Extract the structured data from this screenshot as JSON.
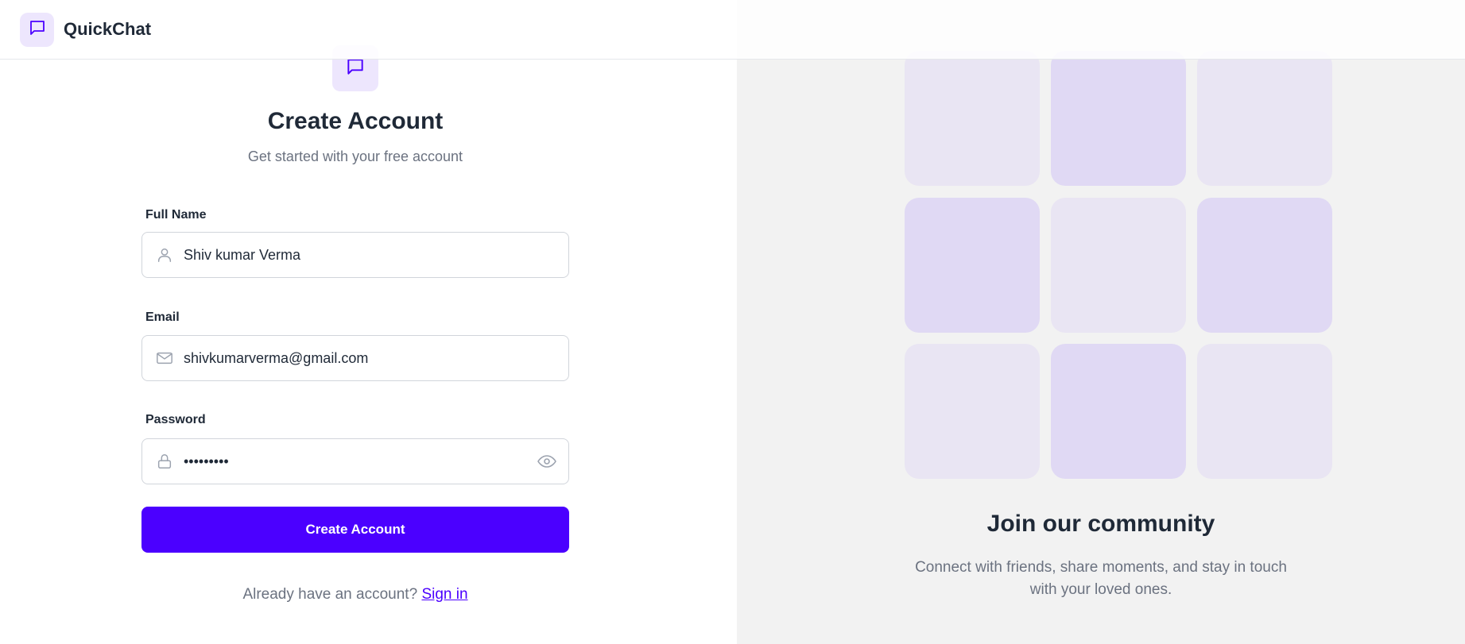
{
  "app": {
    "name": "QuickChat",
    "logo_icon": "chat-bubble-icon",
    "accent": "#4b00ff",
    "badge_bg": "#ede6fd"
  },
  "form": {
    "icon": "chat-bubble-icon",
    "title": "Create Account",
    "subtitle": "Get started with your free account",
    "fields": {
      "name": {
        "label": "Full Name",
        "value": "Shiv kumar Verma",
        "icon": "user-icon"
      },
      "email": {
        "label": "Email",
        "value": "shivkumarverma@gmail.com",
        "icon": "mail-icon"
      },
      "password": {
        "label": "Password",
        "value": "•••••••••",
        "icon": "lock-icon",
        "toggle_icon": "eye-icon"
      }
    },
    "submit_label": "Create Account",
    "signin_prompt": "Already have an account?",
    "signin_link": "Sign in"
  },
  "community": {
    "title": "Join our community",
    "text": "Connect with friends, share moments, and stay in touch with your loved ones.",
    "tile_colors": [
      "#e9e5f3",
      "#e0d9f4"
    ]
  }
}
